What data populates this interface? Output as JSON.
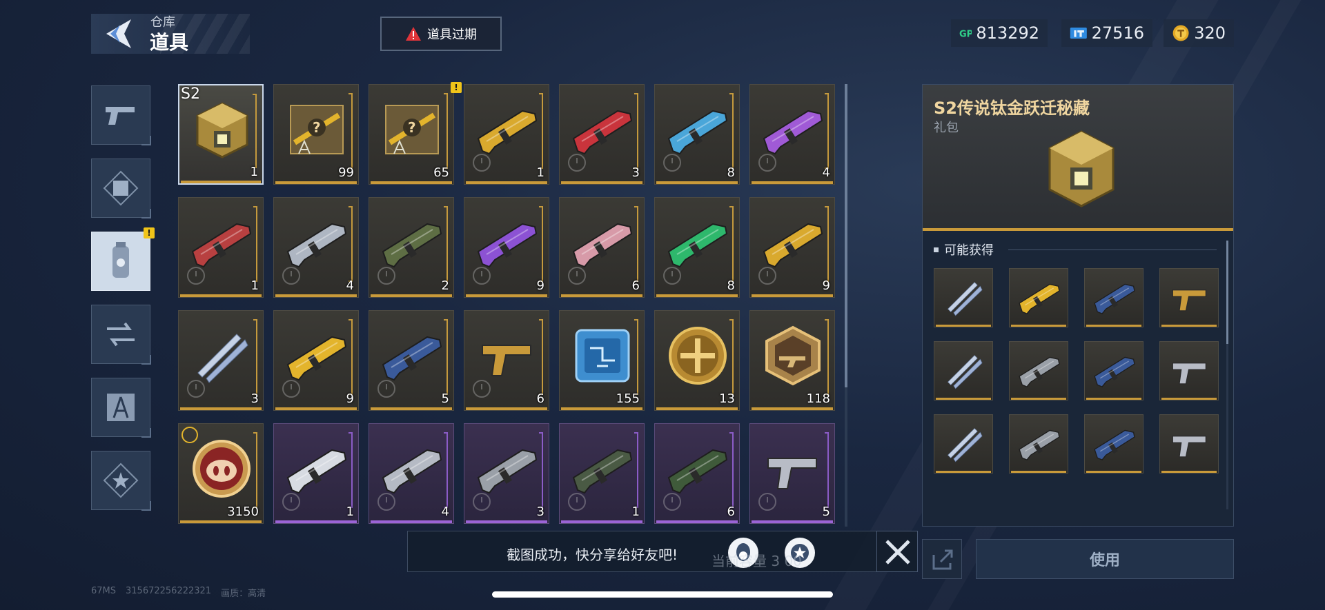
{
  "header": {
    "subtitle": "仓库",
    "title": "道具"
  },
  "expire_button": {
    "label": "道具过期"
  },
  "currencies": [
    {
      "icon": "gp-icon",
      "value": "813292"
    },
    {
      "icon": "ticket-icon",
      "value": "27516"
    },
    {
      "icon": "coin-icon",
      "value": "320"
    }
  ],
  "side_tabs": [
    {
      "icon": "pistol-icon",
      "active": false
    },
    {
      "icon": "frame-icon",
      "active": false
    },
    {
      "icon": "canister-icon",
      "active": true,
      "badge": "!"
    },
    {
      "icon": "transfer-icon",
      "active": false
    },
    {
      "icon": "compass-blueprint-icon",
      "active": false
    },
    {
      "icon": "star-icon",
      "active": false
    }
  ],
  "items": [
    {
      "icon": "legendary-box-icon",
      "count": "1",
      "label": "S2",
      "rarity": "gold",
      "selected": true
    },
    {
      "icon": "mystery-weapon-box-icon",
      "count": "99",
      "rarity": "gold"
    },
    {
      "icon": "mystery-weapon-box-icon",
      "count": "65",
      "rarity": "gold",
      "badge": "!"
    },
    {
      "icon": "rifle-gold-icon",
      "count": "1",
      "rarity": "gold",
      "timed": true
    },
    {
      "icon": "rifle-red-icon",
      "count": "3",
      "rarity": "gold",
      "timed": true
    },
    {
      "icon": "blaster-blue-icon",
      "count": "8",
      "rarity": "gold",
      "timed": true
    },
    {
      "icon": "blaster-purple-icon",
      "count": "4",
      "rarity": "gold",
      "timed": true
    },
    {
      "icon": "sniper-red-icon",
      "count": "1",
      "rarity": "gold",
      "timed": true
    },
    {
      "icon": "sniper-silver-icon",
      "count": "4",
      "rarity": "gold",
      "timed": true
    },
    {
      "icon": "rifle-camo-icon",
      "count": "2",
      "rarity": "gold",
      "timed": true
    },
    {
      "icon": "rifle-violet-icon",
      "count": "9",
      "rarity": "gold",
      "timed": true
    },
    {
      "icon": "rifle-pink-icon",
      "count": "6",
      "rarity": "gold",
      "timed": true
    },
    {
      "icon": "crossbow-green-icon",
      "count": "8",
      "rarity": "gold",
      "timed": true
    },
    {
      "icon": "smg-gold-icon",
      "count": "9",
      "rarity": "gold",
      "timed": true
    },
    {
      "icon": "knives-icon",
      "count": "3",
      "rarity": "gold",
      "timed": true
    },
    {
      "icon": "rifle-yellow-icon",
      "count": "9",
      "rarity": "gold",
      "timed": true
    },
    {
      "icon": "rifle-navy-icon",
      "count": "5",
      "rarity": "gold",
      "timed": true
    },
    {
      "icon": "pistol-gold-icon",
      "count": "6",
      "rarity": "gold",
      "timed": true
    },
    {
      "icon": "chip-icon",
      "count": "155",
      "rarity": "gold"
    },
    {
      "icon": "gold-medal-icon",
      "count": "13",
      "rarity": "gold"
    },
    {
      "icon": "hex-weapon-badge-icon",
      "count": "118",
      "rarity": "gold"
    },
    {
      "icon": "pig-token-icon",
      "count": "3150",
      "rarity": "gold",
      "clock_badge": true
    },
    {
      "icon": "smg-white-icon",
      "count": "1",
      "rarity": "purple",
      "timed": true
    },
    {
      "icon": "shotgun-silver-icon",
      "count": "4",
      "rarity": "purple",
      "timed": true
    },
    {
      "icon": "smg-grey-icon",
      "count": "3",
      "rarity": "purple",
      "timed": true
    },
    {
      "icon": "rifle-dark-icon",
      "count": "1",
      "rarity": "purple",
      "timed": true
    },
    {
      "icon": "launcher-green-icon",
      "count": "6",
      "rarity": "purple",
      "timed": true
    },
    {
      "icon": "pistol-silver-icon",
      "count": "5",
      "rarity": "purple",
      "timed": true
    }
  ],
  "detail": {
    "name": "S2传说钛金跃迁秘藏",
    "type": "礼包",
    "section_title": "可能获得",
    "rewards": [
      "knives-icon",
      "rifle-yellow-icon",
      "rifle-navy-icon",
      "pistol-gold-icon",
      "knives-blueprint-icon",
      "rifle-blueprint-icon",
      "rifle-navy-blueprint-icon",
      "pistol-blueprint-icon",
      "knives-timed-icon",
      "rifle-timed-icon",
      "rifle-navy-timed-icon",
      "pistol-timed-icon"
    ]
  },
  "toast": {
    "message": "截图成功，快分享给好友吧!"
  },
  "capacity_text": "当前容量 3 00",
  "use_button": {
    "label": "使用"
  },
  "status": {
    "ping": "67MS",
    "uid": "315672256222321",
    "quality": "画质：高清"
  },
  "colors": {
    "gold": "#c99a3a",
    "purple": "#9b64d6",
    "accent_text": "#f0d6a0"
  }
}
